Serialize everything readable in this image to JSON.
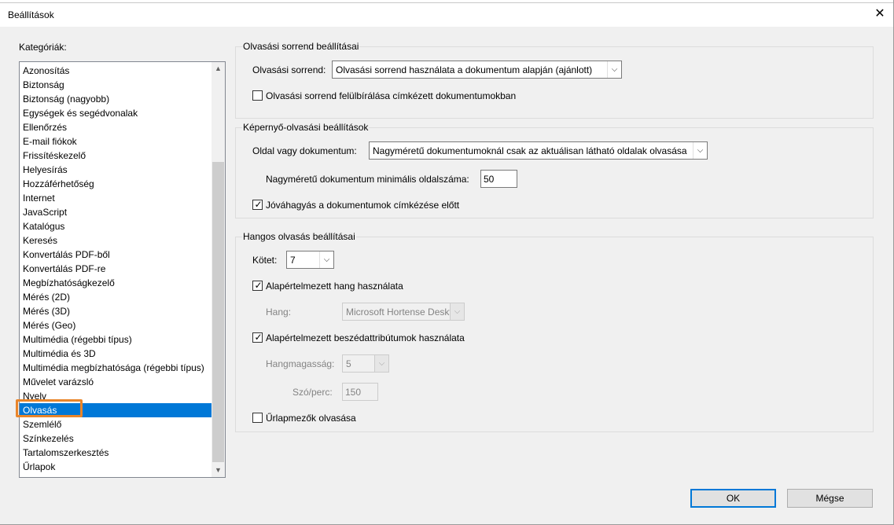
{
  "window": {
    "title": "Beállítások",
    "close_label": "✕"
  },
  "categories_label": "Kategóriák:",
  "categories": [
    "Azonosítás",
    "Biztonság",
    "Biztonság (nagyobb)",
    "Egységek és segédvonalak",
    "Ellenőrzés",
    "E-mail fiókok",
    "Frissítéskezelő",
    "Helyesírás",
    "Hozzáférhetőség",
    "Internet",
    "JavaScript",
    "Katalógus",
    "Keresés",
    "Konvertálás PDF-ből",
    "Konvertálás PDF-re",
    "Megbízhatóságkezelő",
    "Mérés (2D)",
    "Mérés (3D)",
    "Mérés (Geo)",
    "Multimédia (régebbi típus)",
    "Multimédia és 3D",
    "Multimédia megbízhatósága (régebbi típus)",
    "Művelet varázsló",
    "Nyelv",
    "Olvasás",
    "Szemlélő",
    "Színkezelés",
    "Tartalomszerkesztés",
    "Űrlapok"
  ],
  "selected_category": "Olvasás",
  "scroll_icons": {
    "up": "▲",
    "down": "▼"
  },
  "reading_order": {
    "group_title": "Olvasási sorrend beállításai",
    "order_label": "Olvasási sorrend:",
    "order_value": "Olvasási sorrend használata a dokumentum alapján (ajánlott)",
    "override_label": "Olvasási sorrend felülbírálása címkézett dokumentumokban",
    "override_checked": false
  },
  "screen_reader": {
    "group_title": "Képernyő-olvasási beállítások",
    "page_doc_label": "Oldal vagy dokumentum:",
    "page_doc_value": "Nagyméretű dokumentumoknál csak az aktuálisan látható oldalak olvasása",
    "min_pages_label": "Nagyméretű dokumentum minimális oldalszáma:",
    "min_pages_value": "50",
    "confirm_label": "Jóváhagyás a dokumentumok címkézése előtt",
    "confirm_checked": true
  },
  "read_aloud": {
    "group_title": "Hangos olvasás beállításai",
    "volume_label": "Kötet:",
    "volume_value": "7",
    "default_voice_label": "Alapértelmezett hang használata",
    "default_voice_checked": true,
    "voice_label": "Hang:",
    "voice_value": "Microsoft Hortense Deskt",
    "default_speech_label": "Alapértelmezett beszédattribútumok használata",
    "default_speech_checked": true,
    "pitch_label": "Hangmagasság:",
    "pitch_value": "5",
    "wpm_label": "Szó/perc:",
    "wpm_value": "150",
    "form_fields_label": "Űrlapmezők olvasása",
    "form_fields_checked": false
  },
  "buttons": {
    "ok": "OK",
    "cancel": "Mégse"
  },
  "icons": {
    "checkmark": "✓",
    "dropdown": "⌵"
  },
  "colors": {
    "selection": "#0078d7",
    "highlight": "#e9852a"
  }
}
